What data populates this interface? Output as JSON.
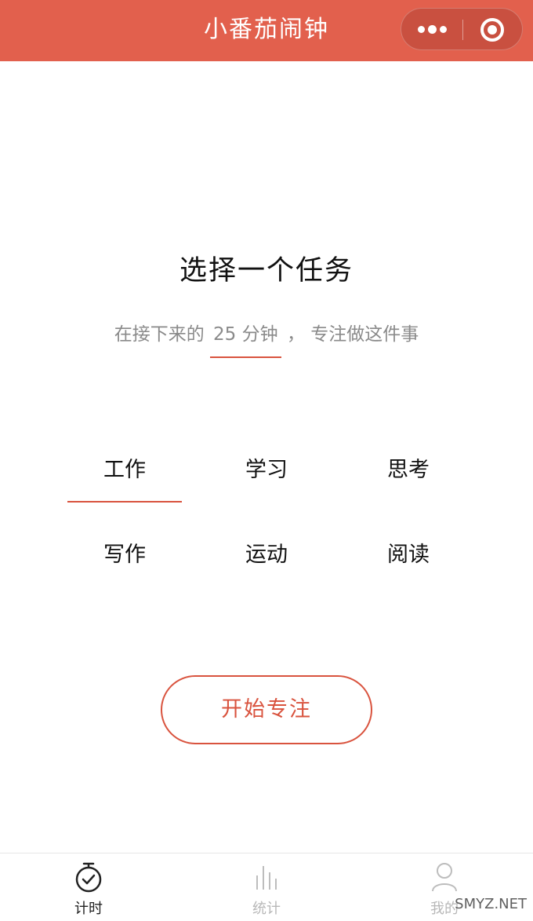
{
  "header": {
    "title": "小番茄闹钟",
    "accent_color": "#e2604d",
    "more_icon": "more-dots-icon",
    "close_icon": "target-circle-icon"
  },
  "main": {
    "heading": "选择一个任务",
    "subtitle_before": "在接下来的",
    "duration": "25 分钟",
    "subtitle_after": "，  专注做这件事",
    "tasks": [
      {
        "label": "工作",
        "selected": true
      },
      {
        "label": "学习",
        "selected": false
      },
      {
        "label": "思考",
        "selected": false
      },
      {
        "label": "写作",
        "selected": false
      },
      {
        "label": "运动",
        "selected": false
      },
      {
        "label": "阅读",
        "selected": false
      }
    ],
    "start_button": "开始专注"
  },
  "tabbar": {
    "tabs": [
      {
        "label": "计时",
        "icon": "stopwatch-icon",
        "active": true
      },
      {
        "label": "统计",
        "icon": "bar-chart-icon",
        "active": false
      },
      {
        "label": "我的",
        "icon": "user-icon",
        "active": false
      }
    ]
  },
  "watermark": "SMYZ.NET"
}
